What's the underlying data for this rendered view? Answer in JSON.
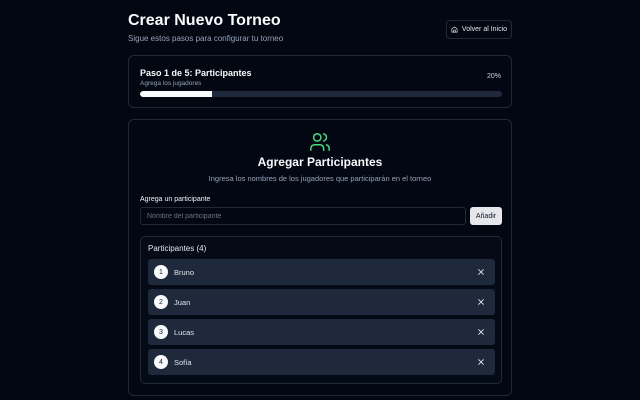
{
  "header": {
    "title": "Crear Nuevo Torneo",
    "subtitle": "Sigue estos pasos para configurar tu torneo",
    "home_button_label": "Volver al Inicio",
    "home_icon": "home-icon"
  },
  "progress": {
    "step_title": "Paso 1 de 5: Participantes",
    "step_subtitle": "Agrega los jugadores",
    "percent_label": "20%",
    "percent_value": 20
  },
  "section": {
    "icon": "users-icon",
    "title": "Agregar Participantes",
    "description": "Ingresa los nombres de los jugadores que participarán en el torneo",
    "accent_color": "#4ade80"
  },
  "form": {
    "label": "Agrega un participante",
    "input_value": "",
    "input_placeholder": "Nombre del participante",
    "add_button_label": "Añadir"
  },
  "participants": {
    "heading": "Participantes (4)",
    "items": [
      {
        "number": "1",
        "name": "Bruno"
      },
      {
        "number": "2",
        "name": "Juan"
      },
      {
        "number": "3",
        "name": "Lucas"
      },
      {
        "number": "4",
        "name": "Sofía"
      }
    ],
    "remove_icon": "close-icon"
  }
}
